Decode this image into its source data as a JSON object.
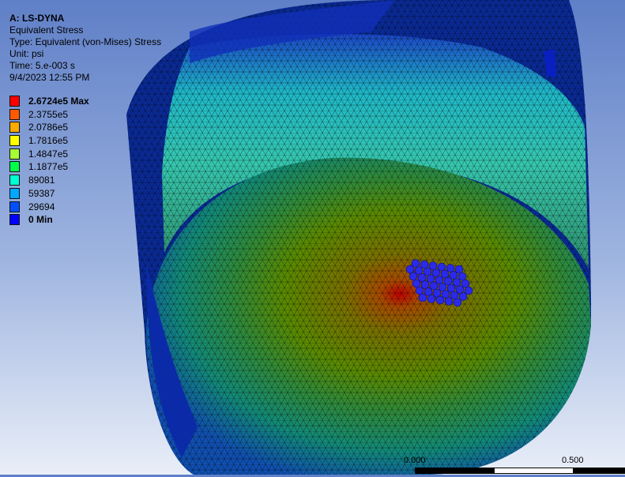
{
  "header": {
    "title": "A: LS-DYNA",
    "result": "Equivalent Stress",
    "type": "Type: Equivalent (von-Mises) Stress",
    "unit": "Unit: psi",
    "time": "Time: 5.e-003 s",
    "date": "9/4/2023 12:55 PM"
  },
  "legend": [
    {
      "label": "2.6724e5 Max",
      "color": "#ff0000",
      "bold": true
    },
    {
      "label": "2.3755e5",
      "color": "#ff5a00",
      "bold": false
    },
    {
      "label": "2.0786e5",
      "color": "#ffaa00",
      "bold": false
    },
    {
      "label": "1.7816e5",
      "color": "#ffff00",
      "bold": false
    },
    {
      "label": "1.4847e5",
      "color": "#a8ff34",
      "bold": false
    },
    {
      "label": "1.1877e5",
      "color": "#00ff4a",
      "bold": false
    },
    {
      "label": "89081",
      "color": "#00ffd2",
      "bold": false
    },
    {
      "label": "59387",
      "color": "#00a8ff",
      "bold": false
    },
    {
      "label": "29694",
      "color": "#0050ff",
      "bold": false
    },
    {
      "label": "0 Min",
      "color": "#0000ff",
      "bold": true
    }
  ],
  "scalebar": {
    "start_label": "0.000",
    "end_label": "0.500"
  }
}
